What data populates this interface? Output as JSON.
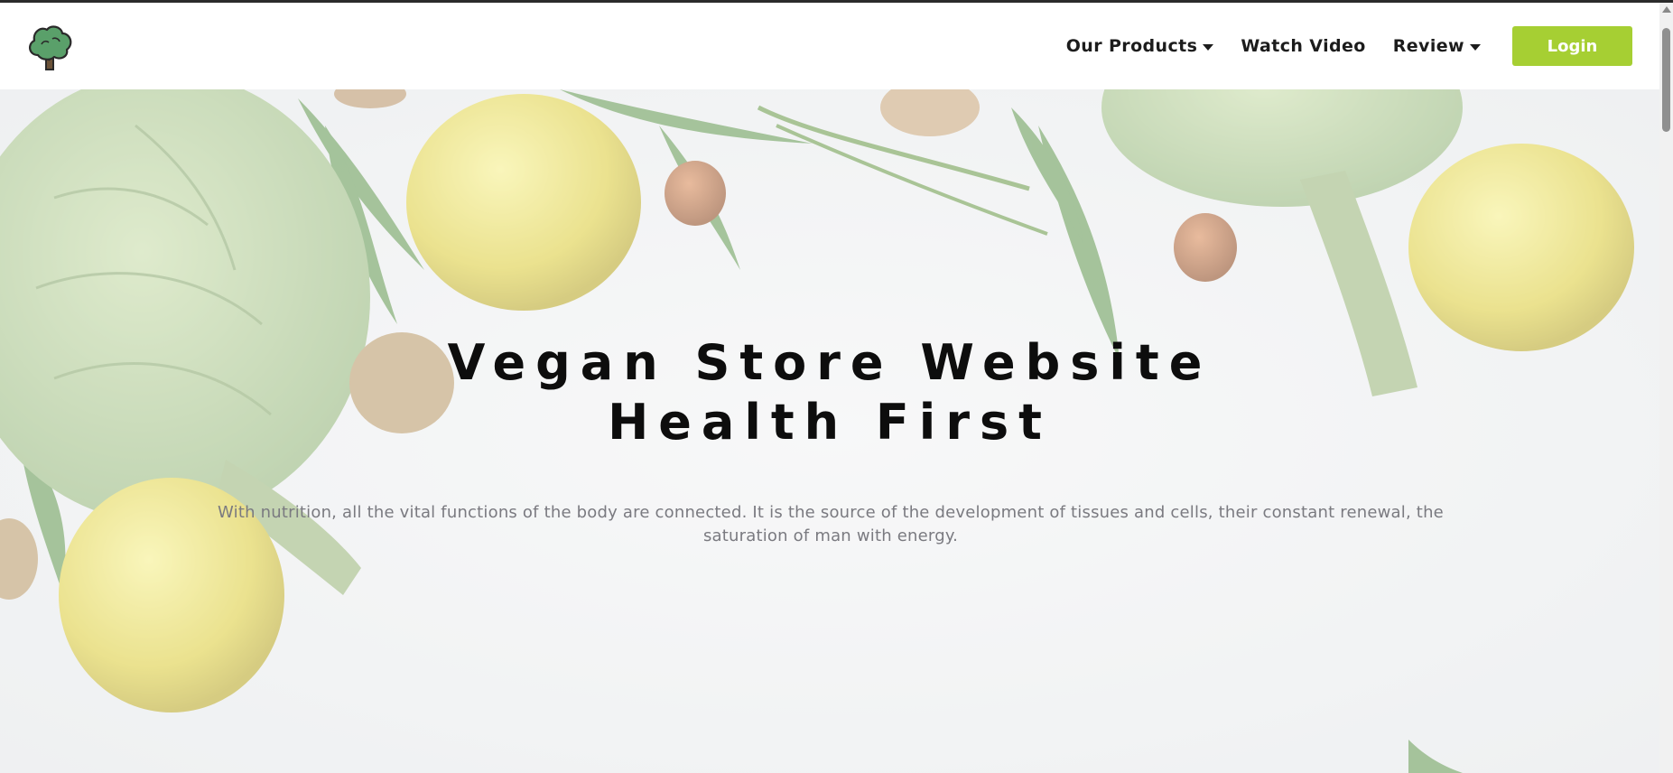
{
  "nav": {
    "items": [
      {
        "label": "Our Products",
        "has_dropdown": true
      },
      {
        "label": "Watch Video",
        "has_dropdown": false
      },
      {
        "label": "Review",
        "has_dropdown": true
      }
    ],
    "login_label": "Login"
  },
  "hero": {
    "title_line1": "Vegan Store Website",
    "title_line2": "Health First",
    "text": "With nutrition, all the vital functions of the body are connected. It is the source of the development of tissues and cells, their constant renewal, the saturation of man with energy."
  },
  "icons": {
    "logo": "tree-logo-icon",
    "dropdown": "caret-down-icon"
  },
  "colors": {
    "accent": "#a6cf33",
    "title": "#0d0d0d",
    "body_text": "#7a7a80"
  }
}
